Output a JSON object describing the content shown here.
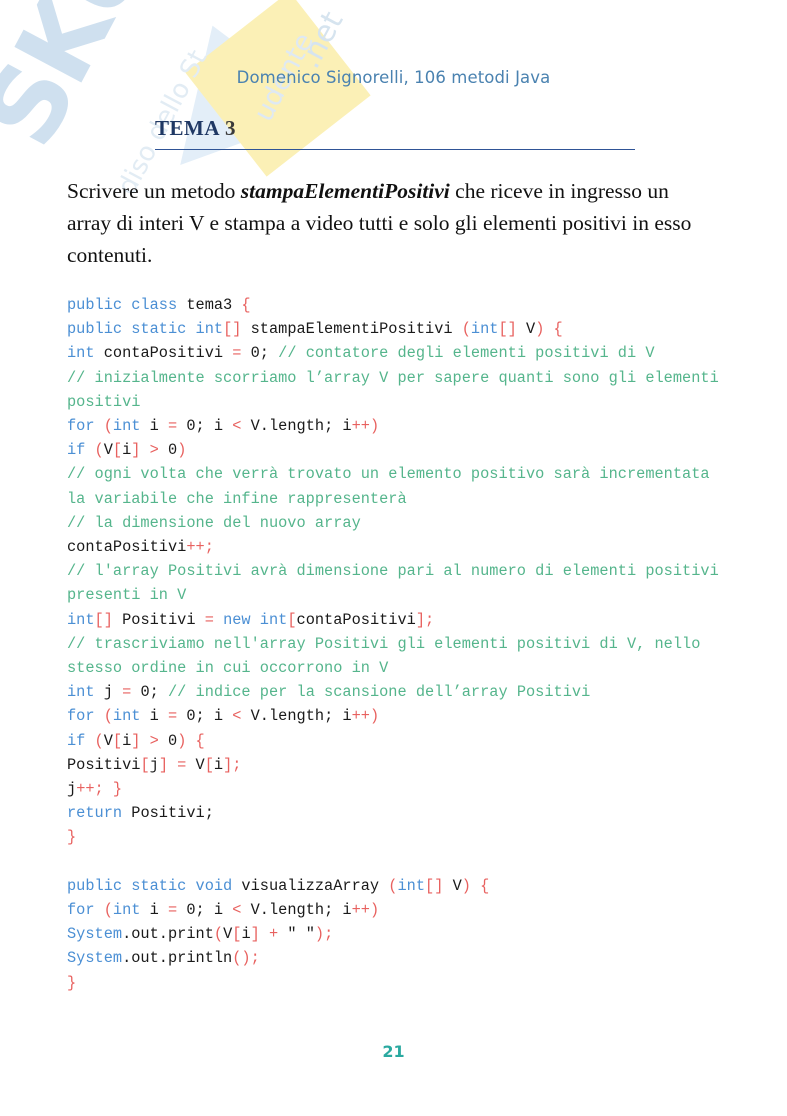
{
  "document": {
    "header": "Domenico Signorelli, 106 metodi Java",
    "section_label": "TEMA",
    "section_number": "3",
    "page_number": "21"
  },
  "watermark": {
    "brand": "SKUOLA",
    "line_a": ".net",
    "line_b": "udente",
    "line_c": "diso dello St"
  },
  "prompt": {
    "before": "Scrivere un metodo ",
    "method_name": "stampaElementiPositivi",
    "after": " che riceve in ingresso un array di interi V e stampa a video tutti e solo gli elementi positivi in esso contenuti."
  },
  "colors": {
    "header_blue": "#4a82b0",
    "title_navy": "#1f3864",
    "rule_blue": "#2f5496",
    "keyword_blue": "#4b8fd4",
    "comment_green": "#55b58c",
    "operator_red": "#e8615f",
    "plain_black": "#1a1a1a",
    "page_number_teal": "#2aa9a0",
    "watermark_blue": "#cfe0ef",
    "watermark_yellow": "#fbf0b6"
  },
  "code": {
    "language": "java",
    "lines": [
      [
        {
          "t": "kw",
          "s": "public class "
        },
        {
          "t": "pl",
          "s": "tema3 "
        },
        {
          "t": "op",
          "s": "{"
        }
      ],
      [
        {
          "t": "kw",
          "s": "public static int"
        },
        {
          "t": "op",
          "s": "[]"
        },
        {
          "t": "pl",
          "s": " stampaElementiPositivi "
        },
        {
          "t": "op",
          "s": "("
        },
        {
          "t": "kw",
          "s": "int"
        },
        {
          "t": "op",
          "s": "[]"
        },
        {
          "t": "pl",
          "s": " V"
        },
        {
          "t": "op",
          "s": ") {"
        }
      ],
      [
        {
          "t": "kw",
          "s": "int"
        },
        {
          "t": "pl",
          "s": " contaPositivi "
        },
        {
          "t": "op",
          "s": "="
        },
        {
          "t": "pl",
          "s": " 0; "
        },
        {
          "t": "cm",
          "s": "// contatore degli elementi positivi di V"
        }
      ],
      [
        {
          "t": "cm",
          "s": "// inizialmente scorriamo l’array V per sapere quanti sono gli elementi positivi"
        }
      ],
      [
        {
          "t": "kw",
          "s": "for "
        },
        {
          "t": "op",
          "s": "("
        },
        {
          "t": "kw",
          "s": "int"
        },
        {
          "t": "pl",
          "s": " i "
        },
        {
          "t": "op",
          "s": "="
        },
        {
          "t": "pl",
          "s": " 0; i "
        },
        {
          "t": "op",
          "s": "<"
        },
        {
          "t": "pl",
          "s": " V.length; i"
        },
        {
          "t": "op",
          "s": "++)"
        }
      ],
      [
        {
          "t": "kw",
          "s": "if "
        },
        {
          "t": "op",
          "s": "("
        },
        {
          "t": "pl",
          "s": "V"
        },
        {
          "t": "op",
          "s": "["
        },
        {
          "t": "pl",
          "s": "i"
        },
        {
          "t": "op",
          "s": "] > "
        },
        {
          "t": "pl",
          "s": "0"
        },
        {
          "t": "op",
          "s": ")"
        }
      ],
      [
        {
          "t": "cm",
          "s": "// ogni volta che verrà trovato un elemento positivo sarà incrementata la variabile che infine rappresenterà"
        }
      ],
      [
        {
          "t": "cm",
          "s": "// la dimensione del nuovo array"
        }
      ],
      [
        {
          "t": "pl",
          "s": "contaPositivi"
        },
        {
          "t": "op",
          "s": "++;"
        }
      ],
      [
        {
          "t": "cm",
          "s": "// l'array Positivi avrà dimensione pari al numero di elementi positivi presenti in V"
        }
      ],
      [
        {
          "t": "kw",
          "s": "int"
        },
        {
          "t": "op",
          "s": "[]"
        },
        {
          "t": "pl",
          "s": " Positivi "
        },
        {
          "t": "op",
          "s": "="
        },
        {
          "t": "kw",
          "s": " new int"
        },
        {
          "t": "op",
          "s": "["
        },
        {
          "t": "pl",
          "s": "contaPositivi"
        },
        {
          "t": "op",
          "s": "];"
        }
      ],
      [
        {
          "t": "cm",
          "s": "// trascriviamo nell'array Positivi gli elementi positivi di V, nello stesso ordine in cui occorrono in V"
        }
      ],
      [
        {
          "t": "kw",
          "s": "int"
        },
        {
          "t": "pl",
          "s": " j "
        },
        {
          "t": "op",
          "s": "="
        },
        {
          "t": "pl",
          "s": " 0; "
        },
        {
          "t": "cm",
          "s": "// indice per la scansione dell’array Positivi"
        }
      ],
      [
        {
          "t": "kw",
          "s": "for "
        },
        {
          "t": "op",
          "s": "("
        },
        {
          "t": "kw",
          "s": "int"
        },
        {
          "t": "pl",
          "s": " i "
        },
        {
          "t": "op",
          "s": "="
        },
        {
          "t": "pl",
          "s": " 0; i "
        },
        {
          "t": "op",
          "s": "<"
        },
        {
          "t": "pl",
          "s": " V.length; i"
        },
        {
          "t": "op",
          "s": "++)"
        }
      ],
      [
        {
          "t": "kw",
          "s": "if "
        },
        {
          "t": "op",
          "s": "("
        },
        {
          "t": "pl",
          "s": "V"
        },
        {
          "t": "op",
          "s": "["
        },
        {
          "t": "pl",
          "s": "i"
        },
        {
          "t": "op",
          "s": "] > "
        },
        {
          "t": "pl",
          "s": "0"
        },
        {
          "t": "op",
          "s": ") {"
        }
      ],
      [
        {
          "t": "pl",
          "s": "Positivi"
        },
        {
          "t": "op",
          "s": "["
        },
        {
          "t": "pl",
          "s": "j"
        },
        {
          "t": "op",
          "s": "] = "
        },
        {
          "t": "pl",
          "s": "V"
        },
        {
          "t": "op",
          "s": "["
        },
        {
          "t": "pl",
          "s": "i"
        },
        {
          "t": "op",
          "s": "];"
        }
      ],
      [
        {
          "t": "pl",
          "s": "j"
        },
        {
          "t": "op",
          "s": "++; }"
        }
      ],
      [
        {
          "t": "kw",
          "s": "return "
        },
        {
          "t": "pl",
          "s": "Positivi;"
        }
      ],
      [
        {
          "t": "op",
          "s": "}"
        }
      ],
      [],
      [
        {
          "t": "kw",
          "s": "public static void "
        },
        {
          "t": "pl",
          "s": "visualizzaArray "
        },
        {
          "t": "op",
          "s": "("
        },
        {
          "t": "kw",
          "s": "int"
        },
        {
          "t": "op",
          "s": "[]"
        },
        {
          "t": "pl",
          "s": " V"
        },
        {
          "t": "op",
          "s": ") {"
        }
      ],
      [
        {
          "t": "kw",
          "s": "for "
        },
        {
          "t": "op",
          "s": "("
        },
        {
          "t": "kw",
          "s": "int"
        },
        {
          "t": "pl",
          "s": " i "
        },
        {
          "t": "op",
          "s": "="
        },
        {
          "t": "pl",
          "s": " 0; i "
        },
        {
          "t": "op",
          "s": "<"
        },
        {
          "t": "pl",
          "s": " V.length; i"
        },
        {
          "t": "op",
          "s": "++)"
        }
      ],
      [
        {
          "t": "kw",
          "s": "System"
        },
        {
          "t": "pl",
          "s": ".out.print"
        },
        {
          "t": "op",
          "s": "("
        },
        {
          "t": "pl",
          "s": "V"
        },
        {
          "t": "op",
          "s": "["
        },
        {
          "t": "pl",
          "s": "i"
        },
        {
          "t": "op",
          "s": "] + "
        },
        {
          "t": "pl",
          "s": "\" \""
        },
        {
          "t": "op",
          "s": ");"
        }
      ],
      [
        {
          "t": "kw",
          "s": "System"
        },
        {
          "t": "pl",
          "s": ".out.println"
        },
        {
          "t": "op",
          "s": "();"
        }
      ],
      [
        {
          "t": "op",
          "s": "}"
        }
      ]
    ]
  }
}
